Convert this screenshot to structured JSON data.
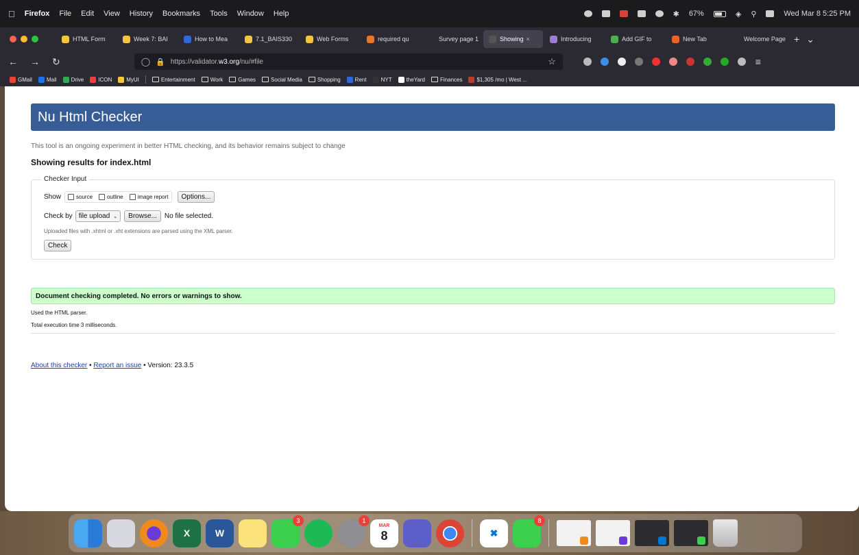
{
  "menubar": {
    "app": "Firefox",
    "menus": [
      "File",
      "Edit",
      "View",
      "History",
      "Bookmarks",
      "Tools",
      "Window",
      "Help"
    ],
    "battery": "67%",
    "clock": "Wed Mar 8  5:25 PM"
  },
  "tabs": [
    {
      "label": "HTML Form",
      "color": "#f5c542"
    },
    {
      "label": "Week 7: BAI",
      "color": "#f5c542"
    },
    {
      "label": "How to Mea",
      "color": "#2d6ad8"
    },
    {
      "label": "7.1_BAIS330",
      "color": "#f5c542"
    },
    {
      "label": "Web Forms",
      "color": "#f5c542"
    },
    {
      "label": "required qu",
      "color": "#e87722"
    },
    {
      "label": "Survey page 1",
      "color": "#2b2a33"
    },
    {
      "label": "Showing",
      "color": "#555",
      "active": true
    },
    {
      "label": "Introducing",
      "color": "#9b7fd4"
    },
    {
      "label": "Add GIF to",
      "color": "#4caf50"
    },
    {
      "label": "New Tab",
      "color": "#e8632c"
    },
    {
      "label": "Welcome Page",
      "color": "#2b2a33"
    }
  ],
  "tab_close": "×",
  "tab_new": "+",
  "tab_list": "⌄",
  "nav": {
    "back": "←",
    "forward": "→",
    "reload": "↻",
    "url_prefix": "https://validator.",
    "url_host": "w3.org",
    "url_suffix": "/nu/#file",
    "star": "☆",
    "menu": "≡"
  },
  "bookmarks": [
    {
      "label": "GMail",
      "type": "icon",
      "color": "#ea4335"
    },
    {
      "label": "Mail",
      "type": "icon",
      "color": "#1a73e8"
    },
    {
      "label": "Drive",
      "type": "icon",
      "color": "#34a853"
    },
    {
      "label": "ICON",
      "type": "icon",
      "color": "#e9413a"
    },
    {
      "label": "MyUI",
      "type": "icon",
      "color": "#f5c542"
    },
    {
      "label": "Entertainment",
      "type": "folder"
    },
    {
      "label": "Work",
      "type": "folder"
    },
    {
      "label": "Games",
      "type": "folder"
    },
    {
      "label": "Social Media",
      "type": "folder"
    },
    {
      "label": "Shopping",
      "type": "folder"
    },
    {
      "label": "Rent",
      "type": "icon",
      "color": "#2d6ad8"
    },
    {
      "label": "NYT",
      "type": "icon",
      "color": "#333"
    },
    {
      "label": "theYard",
      "type": "icon",
      "color": "#fff"
    },
    {
      "label": "Finances",
      "type": "folder"
    },
    {
      "label": "$1,305 /mo | West ...",
      "type": "icon",
      "color": "#c0392b"
    }
  ],
  "page": {
    "banner": "Nu Html Checker",
    "lede": "This tool is an ongoing experiment in better HTML checking, and its behavior remains subject to change",
    "results_heading": "Showing results for index.html",
    "legend": "Checker Input",
    "show_label": "Show",
    "show_options": [
      "source",
      "outline",
      "image report"
    ],
    "options_button": "Options...",
    "check_by_label": "Check by",
    "check_by_value": "file upload",
    "browse_button": "Browse...",
    "no_file": "No file selected.",
    "upload_note": "Uploaded files with .xhtml or .xht extensions are parsed using the XML parser.",
    "check_button": "Check",
    "success_message": "Document checking completed. No errors or warnings to show.",
    "parser_note": "Used the HTML parser.",
    "exec_time": "Total execution time 3 milliseconds.",
    "footer_about": "About this checker",
    "footer_sep1": " • ",
    "footer_report": "Report an issue",
    "footer_version": " • Version: 23.3.5"
  },
  "dock": {
    "messages_badge": "3",
    "settings_badge": "1",
    "calendar_month": "MAR",
    "calendar_day": "8",
    "facetime_badge": "8"
  },
  "colors": {
    "banner": "#365d95",
    "success_bg": "#ccffcc",
    "link": "#1a3dc1"
  }
}
